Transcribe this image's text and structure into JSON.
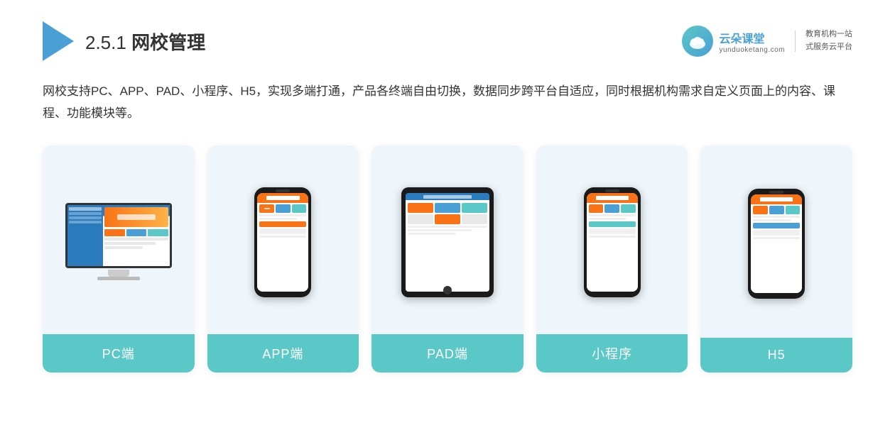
{
  "header": {
    "title_prefix": "2.5.1 ",
    "title_main": "网校管理"
  },
  "brand": {
    "name": "云朵课堂",
    "url": "yunduoketang.com",
    "tagline_line1": "教育机构一站",
    "tagline_line2": "式服务云平台"
  },
  "description": {
    "text": "网校支持PC、APP、PAD、小程序、H5，实现多端打通，产品各终端自由切换，数据同步跨平台自适应，同时根据机构需求自定义页面上的内容、课程、功能模块等。"
  },
  "cards": [
    {
      "id": "pc",
      "label": "PC端",
      "device_type": "desktop"
    },
    {
      "id": "app",
      "label": "APP端",
      "device_type": "phone"
    },
    {
      "id": "pad",
      "label": "PAD端",
      "device_type": "tablet"
    },
    {
      "id": "miniprogram",
      "label": "小程序",
      "device_type": "phone"
    },
    {
      "id": "h5",
      "label": "H5",
      "device_type": "phone"
    }
  ]
}
